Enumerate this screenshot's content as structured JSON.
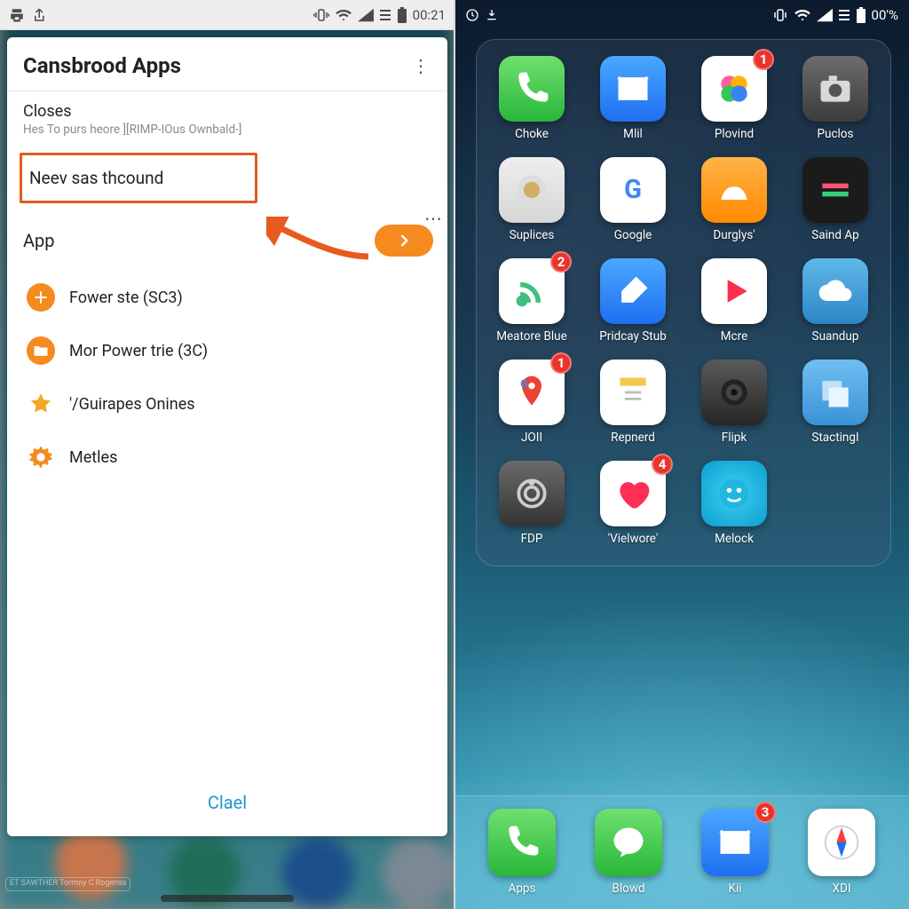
{
  "left": {
    "status": {
      "time": "00:21"
    },
    "card_title": "Cansbrood Apps",
    "closes": {
      "title": "Closes",
      "subtitle": "Hes To purs heore ][RIMP-IOus Ownbald-]"
    },
    "highlighted_item": "Neev sas thcound",
    "app_row_label": "App",
    "list": [
      {
        "label": "Fower ste (SC3)",
        "icon": "plus",
        "color": "#f58a1f"
      },
      {
        "label": "Mor Power trie (3C)",
        "icon": "folder",
        "color": "#f58a1f"
      },
      {
        "label": "'/Guirapes Onines",
        "icon": "star",
        "color": "#f5a623"
      },
      {
        "label": "Metles",
        "icon": "gear",
        "color": "#f58a1f"
      }
    ],
    "footer_button": "Clael",
    "watermark": "ET SAWTHER\nTormny C Rogenss"
  },
  "right": {
    "status": {
      "time": "00'%",
      "battery_icon": "battery-full"
    },
    "folder_apps": [
      {
        "name": "Choke",
        "icon": "phone",
        "bg": "linear-gradient(#6fe06f,#29b73a)",
        "fg": "#fff"
      },
      {
        "name": "Mlil",
        "icon": "envelope",
        "bg": "linear-gradient(#4aa8ff,#1e6ff0)",
        "fg": "#fff"
      },
      {
        "name": "Plovind",
        "icon": "flower",
        "bg": "#ffffff",
        "fg": "#ff4da6",
        "badge": "1"
      },
      {
        "name": "Puclos",
        "icon": "camera",
        "bg": "linear-gradient(#6c6c6c,#3c3c3c)",
        "fg": "#d9d9d9"
      },
      {
        "name": "Suplices",
        "icon": "blur",
        "bg": "linear-gradient(#eeeeee,#d7d7d7)",
        "fg": "#c8b070"
      },
      {
        "name": "Google",
        "icon": "g",
        "bg": "#ffffff",
        "fg": "#4285F4"
      },
      {
        "name": "Durglys'",
        "icon": "fan",
        "bg": "linear-gradient(#ffb347,#ff8a00)",
        "fg": "#fff"
      },
      {
        "name": "Saind Ap",
        "icon": "bars",
        "bg": "#1b1b1b",
        "fg": "#ff5577"
      },
      {
        "name": "Meatore Blue",
        "icon": "rss",
        "bg": "#ffffff",
        "fg": "#3fbf7f",
        "badge": "2"
      },
      {
        "name": "Pridcay Stub",
        "icon": "brush",
        "bg": "linear-gradient(#4aa8ff,#1e6ff0)",
        "fg": "#fff"
      },
      {
        "name": "Mcre",
        "icon": "play",
        "bg": "#ffffff",
        "fg": "#ff2e4d"
      },
      {
        "name": "Suandup",
        "icon": "cloud",
        "bg": "linear-gradient(#5fb8e8,#2d85c6)",
        "fg": "#fff"
      },
      {
        "name": "JOII",
        "icon": "maps",
        "bg": "#ffffff",
        "fg": "#34a853",
        "badge": "1"
      },
      {
        "name": "Repnerd",
        "icon": "notes",
        "bg": "#ffffff",
        "fg": "#f4c94b"
      },
      {
        "name": "Flipk",
        "icon": "lens",
        "bg": "linear-gradient(#5a5a5a,#262626)",
        "fg": "#9a9a9a"
      },
      {
        "name": "StactingI",
        "icon": "stack",
        "bg": "linear-gradient(#6fbff2,#3a92d6)",
        "fg": "#eaf6ff"
      },
      {
        "name": "FDP",
        "icon": "dial",
        "bg": "linear-gradient(#6a6a6a,#343434)",
        "fg": "#cfcfcf"
      },
      {
        "name": "'Vielwore'",
        "icon": "heart",
        "bg": "#ffffff",
        "fg": "#ff2e55",
        "badge": "4"
      },
      {
        "name": "Melock",
        "icon": "face",
        "bg": "radial-gradient(circle,#3fd0ef,#0a9ed0)",
        "fg": "#e9fbff"
      }
    ],
    "pager": {
      "count": 4,
      "active": 0
    },
    "dock": [
      {
        "name": "Apps",
        "icon": "phone",
        "bg": "linear-gradient(#6fe06f,#29b73a)",
        "fg": "#fff"
      },
      {
        "name": "Blowd",
        "icon": "bubble",
        "bg": "linear-gradient(#6fe06f,#29b73a)",
        "fg": "#fff"
      },
      {
        "name": "Kii",
        "icon": "envelope",
        "bg": "linear-gradient(#4aa8ff,#1e6ff0)",
        "fg": "#fff",
        "badge": "3"
      },
      {
        "name": "XDI",
        "icon": "compass",
        "bg": "#ffffff",
        "fg": "#1e6ff0"
      }
    ]
  }
}
